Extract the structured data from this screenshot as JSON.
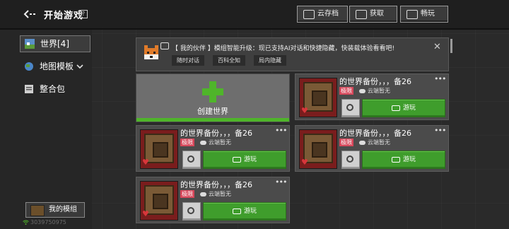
{
  "header": {
    "title": "开始游戏",
    "help": "?",
    "buttons": [
      {
        "label": "云存档",
        "icon": "cloud-save-icon"
      },
      {
        "label": "获取",
        "icon": "store-icon"
      },
      {
        "label": "畅玩",
        "icon": "gamepad-icon"
      }
    ]
  },
  "sidebar": {
    "items": [
      {
        "label": "世界[4]",
        "icon": "world-icon",
        "active": true
      },
      {
        "label": "地图模板",
        "icon": "globe-icon",
        "chevron": "chevron-down-icon"
      },
      {
        "label": "整合包",
        "icon": "pack-icon"
      }
    ],
    "my_mods": {
      "label": "我的模组",
      "icon": "bookshelf-icon"
    },
    "user_id": "3039750975"
  },
  "banner": {
    "text": "【 我的伙伴 】模组智能升级：现已支持AI对话和快捷隐藏，快装载体验看看吧!",
    "chips": [
      "随时对话",
      "百科全知",
      "局内隐藏"
    ],
    "close": "✕"
  },
  "create_world": {
    "label": "创建世界"
  },
  "worlds": [
    {
      "name": "的世界备份，，，备26",
      "mode": "极限",
      "cloud_status": "云端暂无",
      "play_label": "游玩"
    },
    {
      "name": "的世界备份，，，备26",
      "mode": "极限",
      "cloud_status": "云端暂无",
      "play_label": "游玩"
    },
    {
      "name": "的世界备份，，，备26",
      "mode": "极限",
      "cloud_status": "云端暂无",
      "play_label": "游玩"
    },
    {
      "name": "的世界备份，，，备26",
      "mode": "极限",
      "cloud_status": "云端暂无",
      "play_label": "游玩"
    }
  ],
  "colors": {
    "play_green": "#3f9d2c",
    "accent_green": "#4fb52a",
    "hardcore_tag": "#d6475a"
  }
}
